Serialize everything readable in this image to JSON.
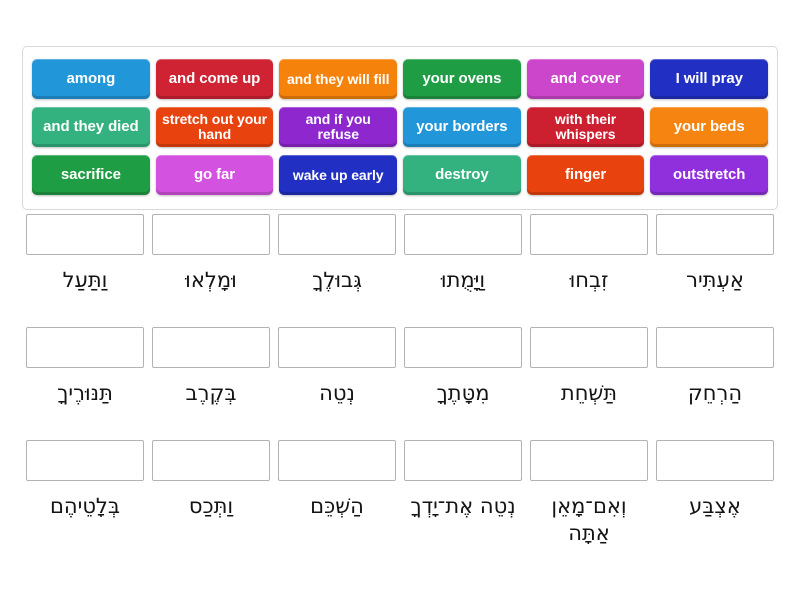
{
  "activity": {
    "type": "drag-and-drop-match",
    "tile_text_color": "#ffffff",
    "dropzone_border_color": "#b3b3b3",
    "panel_border_color": "#d9d9d9",
    "background": "#ffffff"
  },
  "tile_bank": {
    "rows": [
      [
        {
          "label": "among",
          "color": "#2196d8",
          "lines": 1
        },
        {
          "label": "and come up",
          "color": "#cf2233",
          "lines": 1
        },
        {
          "label": "and they will fill",
          "color": "#f5820b",
          "lines": 2
        },
        {
          "label": "your ovens",
          "color": "#1f9d44",
          "lines": 1
        },
        {
          "label": "and cover",
          "color": "#cc46cc",
          "lines": 1
        },
        {
          "label": "I will pray",
          "color": "#2130c2",
          "lines": 1
        }
      ],
      [
        {
          "label": "and they died",
          "color": "#33b280",
          "lines": 1
        },
        {
          "label": "stretch out your hand",
          "color": "#e8430f",
          "lines": 2
        },
        {
          "label": "and if you refuse",
          "color": "#8f27cf",
          "lines": 2
        },
        {
          "label": "your borders",
          "color": "#2196d8",
          "lines": 1
        },
        {
          "label": "with their whispers",
          "color": "#cc2030",
          "lines": 2
        },
        {
          "label": "your beds",
          "color": "#f58410",
          "lines": 1
        }
      ],
      [
        {
          "label": "sacrifice",
          "color": "#1f9d44",
          "lines": 1
        },
        {
          "label": "go far",
          "color": "#d452e0",
          "lines": 1
        },
        {
          "label": "wake up early",
          "color": "#2130c2",
          "lines": 2
        },
        {
          "label": "destroy",
          "color": "#33b280",
          "lines": 1
        },
        {
          "label": "finger",
          "color": "#e8430f",
          "lines": 1
        },
        {
          "label": "outstretch",
          "color": "#9030dd",
          "lines": 1
        }
      ]
    ]
  },
  "answer_grid": {
    "rows": [
      [
        {
          "hebrew": "וַתַּעַל",
          "dropzone_value": ""
        },
        {
          "hebrew": "וּמָלְאוּ",
          "dropzone_value": ""
        },
        {
          "hebrew": "גְּבוּלֶךָ",
          "dropzone_value": ""
        },
        {
          "hebrew": "וַיָּמֻתוּ",
          "dropzone_value": ""
        },
        {
          "hebrew": "זִבְחוּ",
          "dropzone_value": ""
        },
        {
          "hebrew": "אַעְתִּיר",
          "dropzone_value": ""
        }
      ],
      [
        {
          "hebrew": "תַּנּוּרֶיךָ",
          "dropzone_value": ""
        },
        {
          "hebrew": "בְּקֶרֶב",
          "dropzone_value": ""
        },
        {
          "hebrew": "נְטֵה",
          "dropzone_value": ""
        },
        {
          "hebrew": "מִטָּתֶךָ",
          "dropzone_value": ""
        },
        {
          "hebrew": "תַּשְׁחֵת",
          "dropzone_value": ""
        },
        {
          "hebrew": "הַרְחֵק",
          "dropzone_value": ""
        }
      ],
      [
        {
          "hebrew": "בְּלָטֵיהֶם",
          "dropzone_value": ""
        },
        {
          "hebrew": "וַתְּכַס",
          "dropzone_value": ""
        },
        {
          "hebrew": "הַשְׁכֵּם",
          "dropzone_value": ""
        },
        {
          "hebrew": "נְטֵה אֶת־יָדְךָ",
          "dropzone_value": ""
        },
        {
          "hebrew": "וְאִם־מָאֵן אַתָּה",
          "dropzone_value": ""
        },
        {
          "hebrew": "אֶצְבַּע",
          "dropzone_value": ""
        }
      ]
    ]
  }
}
